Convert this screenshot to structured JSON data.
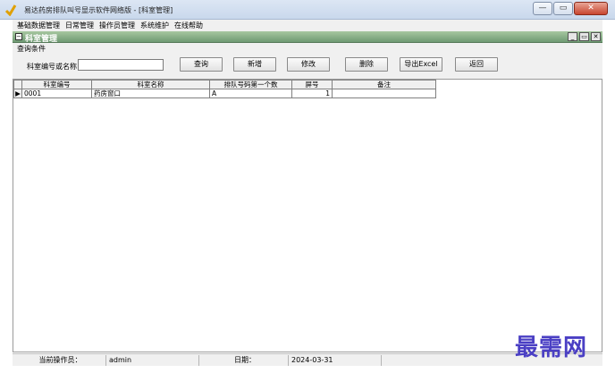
{
  "window": {
    "title": "易达药房排队叫号显示软件网络版    - [科室管理]",
    "buttons": [
      "—",
      "▭",
      "✕"
    ]
  },
  "menu": [
    "基础数据管理",
    "日常管理",
    "操作员管理",
    "系统维护",
    "在线帮助"
  ],
  "child_window": {
    "title": "科室管理",
    "buttons": [
      "_",
      "▭",
      "✕"
    ]
  },
  "query": {
    "group_label": "查询条件",
    "field_label": "科室编号或名称",
    "input_value": "",
    "buttons": {
      "query": "查询",
      "add": "新增",
      "edit": "修改",
      "delete": "删除",
      "export": "导出Excel",
      "back": "返回"
    }
  },
  "grid": {
    "columns": [
      "科室编号",
      "科室名称",
      "排队号码第一个数",
      "屏号",
      "备注"
    ],
    "rows": [
      {
        "code": "0001",
        "name": "药房窗口",
        "first_char": "A",
        "screen": "1",
        "note": ""
      }
    ]
  },
  "status": {
    "operator_label": "当前操作员：",
    "operator": "admin",
    "date_label": "日期：",
    "date": "2024-03-31"
  },
  "watermark": "最需网"
}
